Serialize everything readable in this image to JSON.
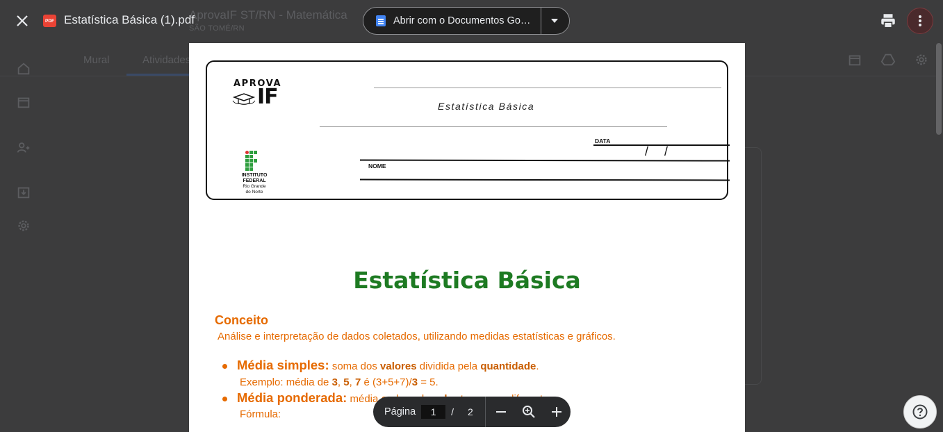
{
  "background": {
    "class_title": "AprovaIF ST/RN - Matemática",
    "class_subtitle": "SÃO TOMÉ/RN",
    "tabs": [
      "Mural",
      "Atividades"
    ],
    "rail_icons": [
      "home-icon",
      "calendar-icon",
      "people-icon",
      "archive-icon",
      "settings-icon"
    ],
    "top_icons": [
      "calendar-icon",
      "drive-icon",
      "settings-icon"
    ]
  },
  "viewer": {
    "file_badge": "PDF",
    "file_name": "Estatística Básica (1).pdf",
    "open_with_label": "Abrir com o Documentos Go…",
    "page_label": "Página",
    "current_page": "1",
    "page_separator": "/",
    "total_pages": "2"
  },
  "document": {
    "logo_word": "APROVA",
    "logo_mark": "IF",
    "header_title": "Estatística Básica",
    "date_label": "DATA",
    "date_slashes": "/ /",
    "name_label": "NOME",
    "institute_line1": "INSTITUTO",
    "institute_line2": "FEDERAL",
    "institute_line3": "Rio Grande",
    "institute_line4": "do Norte",
    "title": "Estatística Básica",
    "section_concept": "Conceito",
    "concept_text": "Análise e interpretação de dados coletados, utilizando medidas estatísticas e gráficos.",
    "bullet1_head": "Média simples:",
    "bullet1_pre": "soma dos",
    "bullet1_b1": "valores",
    "bullet1_mid": "dividida pela",
    "bullet1_b2": "quantidade",
    "bullet1_end": ".",
    "example_pre": "Exemplo: média de",
    "example_n1": "3",
    "example_c1": ",",
    "example_n2": "5",
    "example_c2": ",",
    "example_n3": "7",
    "example_mid": "é (3+5+7)/",
    "example_n4": "3",
    "example_end": "= 5.",
    "bullet2_head": "Média ponderada:",
    "bullet2_pre": "média onde cada",
    "bullet2_b1": "valor",
    "bullet2_mid": "tem",
    "bullet2_b2": "peso",
    "bullet2_end": "diferente.",
    "formula_label": "Fórmula:"
  },
  "colors": {
    "title_green": "#1d7a22",
    "accent_orange": "#e66a00",
    "viewer_bg": "#3c3c3d"
  }
}
